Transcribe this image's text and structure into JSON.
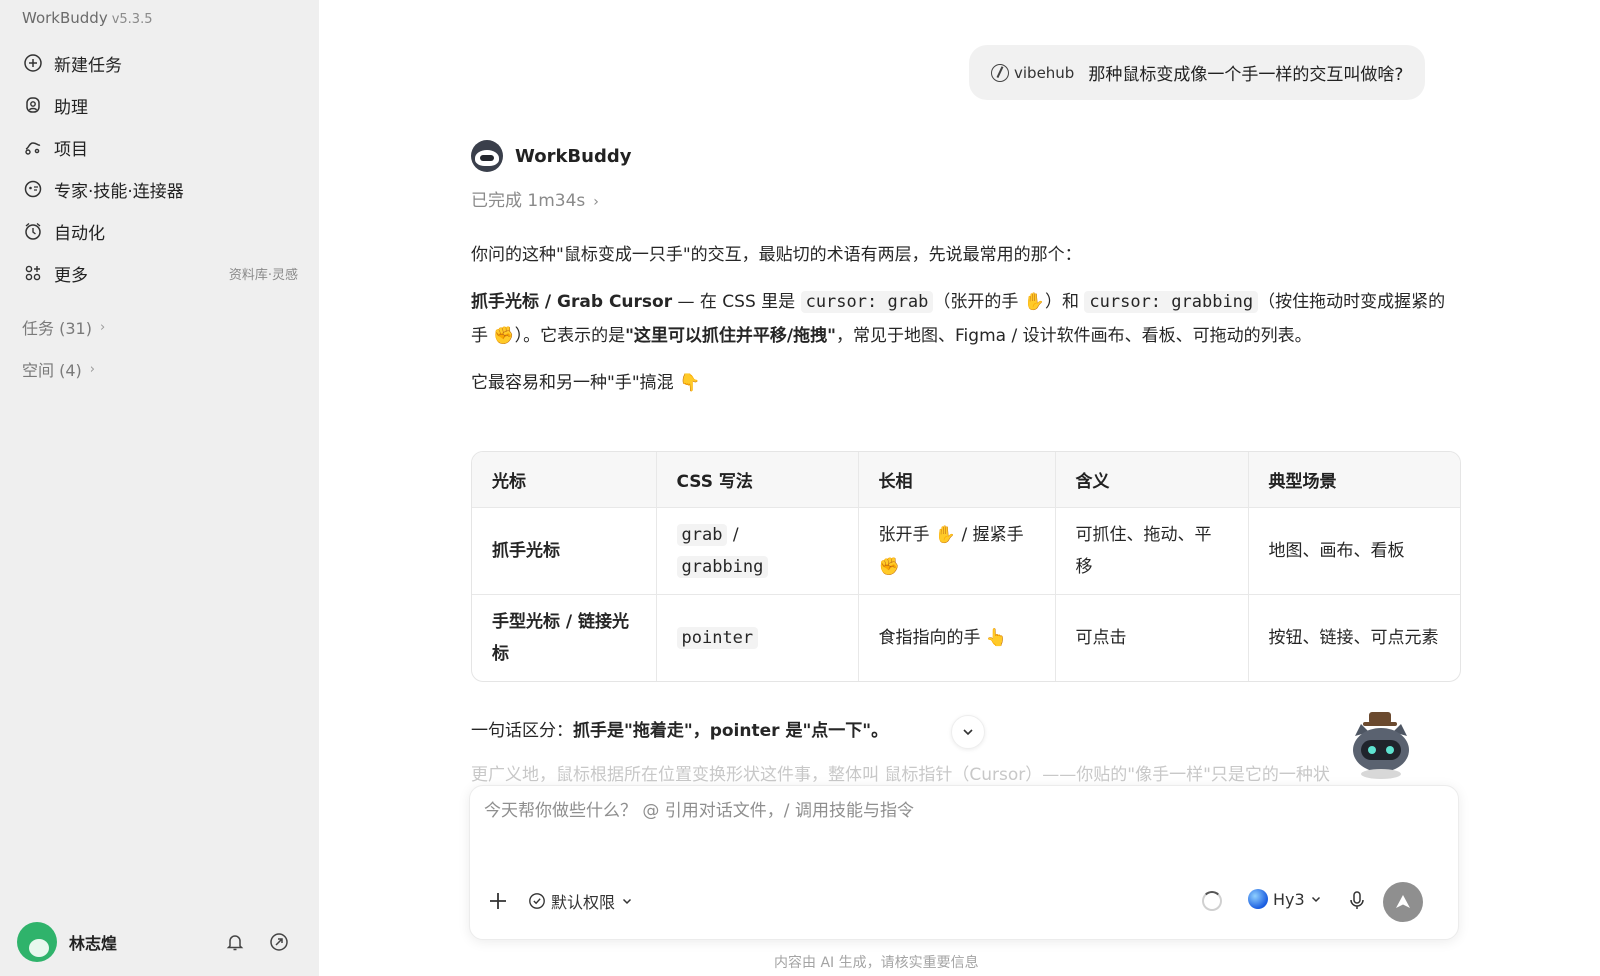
{
  "app": {
    "name": "WorkBuddy",
    "version": "v5.3.5"
  },
  "sidebar": {
    "items": [
      {
        "label": "新建任务",
        "icon": "plus-circle-icon"
      },
      {
        "label": "助理",
        "icon": "assistant-icon"
      },
      {
        "label": "项目",
        "icon": "project-icon"
      },
      {
        "label": "专家·技能·连接器",
        "icon": "expert-icon"
      },
      {
        "label": "自动化",
        "icon": "alarm-clock-icon"
      },
      {
        "label": "更多",
        "icon": "apps-icon",
        "extra": "资料库·灵感"
      }
    ],
    "groups": [
      {
        "label": "任务 (31)"
      },
      {
        "label": "空间 (4)"
      }
    ],
    "user": {
      "name": "林志煌"
    }
  },
  "chat": {
    "user_message": {
      "chip": "vibehub",
      "text": "那种鼠标变成像一个手一样的交互叫做啥?"
    },
    "bot": {
      "name": "WorkBuddy",
      "status": "已完成 1m34s"
    },
    "para1": "你问的这种\"鼠标变成一只手\"的交互，最贴切的术语有两层，先说最常用的那个：",
    "para2": {
      "b1": "抓手光标 / Grab Cursor",
      "t1": " — 在 CSS 里是 ",
      "c1": "cursor: grab",
      "t2": "（张开的手 ✋）和 ",
      "c2": "cursor: grabbing",
      "t3": "（按住拖动时变成握紧的手 ✊）。它表示的是",
      "b2": "\"这里可以抓住并平移/拖拽\"",
      "t4": "，常见于地图、Figma / 设计软件画布、看板、可拖动的列表。"
    },
    "para3": "它最容易和另一种\"手\"搞混 👇",
    "table": {
      "headers": [
        "光标",
        "CSS 写法",
        "长相",
        "含义",
        "典型场景"
      ],
      "rows": [
        {
          "name": "抓手光标",
          "css": "grab",
          "css2": "grabbing",
          "look": "张开手 ✋ / 握紧手 ✊",
          "meaning": "可抓住、拖动、平移",
          "scene": "地图、画布、看板"
        },
        {
          "name": "手型光标 / 链接光标",
          "css": "pointer",
          "css2": "",
          "look": "食指指向的手 👆",
          "meaning": "可点击",
          "scene": "按钮、链接、可点元素"
        }
      ]
    },
    "summary": {
      "prefix": "一句话区分：",
      "bold": "抓手是\"拖着走\"，pointer 是\"点一下\"。"
    },
    "faded": "更广义地，鼠标根据所在位置变换形状这件事，整体叫 鼠标指针（Cursor）——你贴的\"像手一样\"只是它的一种状"
  },
  "composer": {
    "placeholder": "今天帮你做些什么？ @ 引用对话文件，/ 调用技能与指令",
    "permission": "默认权限",
    "model": "Hy3",
    "disclaimer": "内容由 AI 生成，请核实重要信息"
  },
  "colors": {
    "sidebar_bg": "#efefef",
    "accent_green": "#2fb36b",
    "send_button": "#8f8f8f"
  }
}
